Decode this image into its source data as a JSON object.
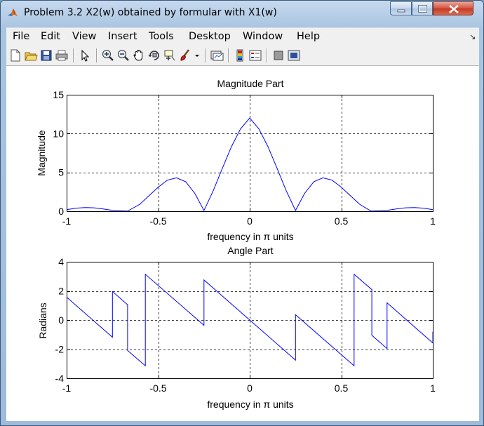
{
  "window": {
    "title": "Problem 3.2 X2(w) obtained by formular with X1(w)"
  },
  "menu": [
    "File",
    "Edit",
    "View",
    "Insert",
    "Tools",
    "Desktop",
    "Window",
    "Help"
  ],
  "toolbar_icons": [
    "new-file-icon",
    "open-folder-icon",
    "save-icon",
    "print-icon",
    "pointer-icon",
    "zoom-in-icon",
    "zoom-out-icon",
    "pan-hand-icon",
    "rotate-3d-icon",
    "data-cursor-icon",
    "brush-icon",
    "dropdown-arrow-icon",
    "link-plot-icon",
    "colorbar-icon",
    "legend-icon",
    "hide-plot-tools-icon",
    "show-plot-tools-icon"
  ],
  "colors": {
    "line": "#0000ff",
    "axes": "#000000",
    "grid": "#000000",
    "canvas": "#ffffff"
  },
  "chart_data": [
    {
      "type": "line",
      "title": "Magnitude Part",
      "xlabel": "frequency in π units",
      "ylabel": "Magnitude",
      "xlim": [
        -1,
        1
      ],
      "ylim": [
        0,
        15
      ],
      "xticks": [
        -1,
        -0.5,
        0,
        0.5,
        1
      ],
      "xtick_labels": [
        "-1",
        "-0.5",
        "0",
        "0.5",
        "1"
      ],
      "yticks": [
        0,
        5,
        10,
        15
      ],
      "ytick_labels": [
        "0",
        "5",
        "10",
        "15"
      ],
      "grid": true,
      "series": [
        {
          "x": [
            -1,
            -0.95,
            -0.9,
            -0.85,
            -0.8,
            -0.75,
            -0.7,
            -0.667,
            -0.6,
            -0.55,
            -0.5,
            -0.45,
            -0.4,
            -0.35,
            -0.3,
            -0.25,
            -0.2,
            -0.15,
            -0.1,
            -0.05,
            0,
            0.05,
            0.1,
            0.15,
            0.2,
            0.25,
            0.3,
            0.35,
            0.4,
            0.45,
            0.5,
            0.55,
            0.6,
            0.65,
            0.667,
            0.7,
            0.75,
            0.8,
            0.85,
            0.9,
            0.95,
            1
          ],
          "y": [
            0.2,
            0.4,
            0.48,
            0.44,
            0.3,
            0.12,
            0.05,
            0.02,
            0.9,
            2.0,
            3.1,
            4.0,
            4.3,
            3.8,
            2.3,
            0.1,
            2.6,
            5.5,
            8.3,
            10.6,
            12.0,
            10.6,
            8.3,
            5.5,
            2.6,
            0.1,
            2.3,
            3.8,
            4.3,
            4.0,
            3.1,
            2.0,
            0.9,
            0.2,
            0.02,
            0.05,
            0.12,
            0.3,
            0.44,
            0.48,
            0.4,
            0.2
          ]
        }
      ]
    },
    {
      "type": "line",
      "title": "Angle Part",
      "xlabel": "frequency in π units",
      "ylabel": "Radians",
      "xlim": [
        -1,
        1
      ],
      "ylim": [
        -4,
        4
      ],
      "xticks": [
        -1,
        -0.5,
        0,
        0.5,
        1
      ],
      "xtick_labels": [
        "-1",
        "-0.5",
        "0",
        "0.5",
        "1"
      ],
      "yticks": [
        -4,
        -2,
        0,
        2,
        4
      ],
      "ytick_labels": [
        "-4",
        "-2",
        "0",
        "2",
        "4"
      ],
      "grid": true,
      "series": [
        {
          "x": [
            -1,
            -0.75,
            -0.75,
            -0.667,
            -0.667,
            -0.57,
            -0.57,
            -0.25,
            -0.25,
            0,
            0.25,
            0.25,
            0.57,
            0.57,
            0.667,
            0.667,
            0.75,
            0.75,
            1,
            1
          ],
          "y": [
            1.57,
            -1.18,
            1.96,
            1.05,
            -2.09,
            -3.14,
            3.14,
            -0.36,
            2.75,
            0,
            -2.75,
            0.36,
            -3.14,
            3.14,
            2.09,
            -1.05,
            -1.96,
            1.18,
            -1.57,
            -0.8
          ]
        }
      ]
    }
  ]
}
